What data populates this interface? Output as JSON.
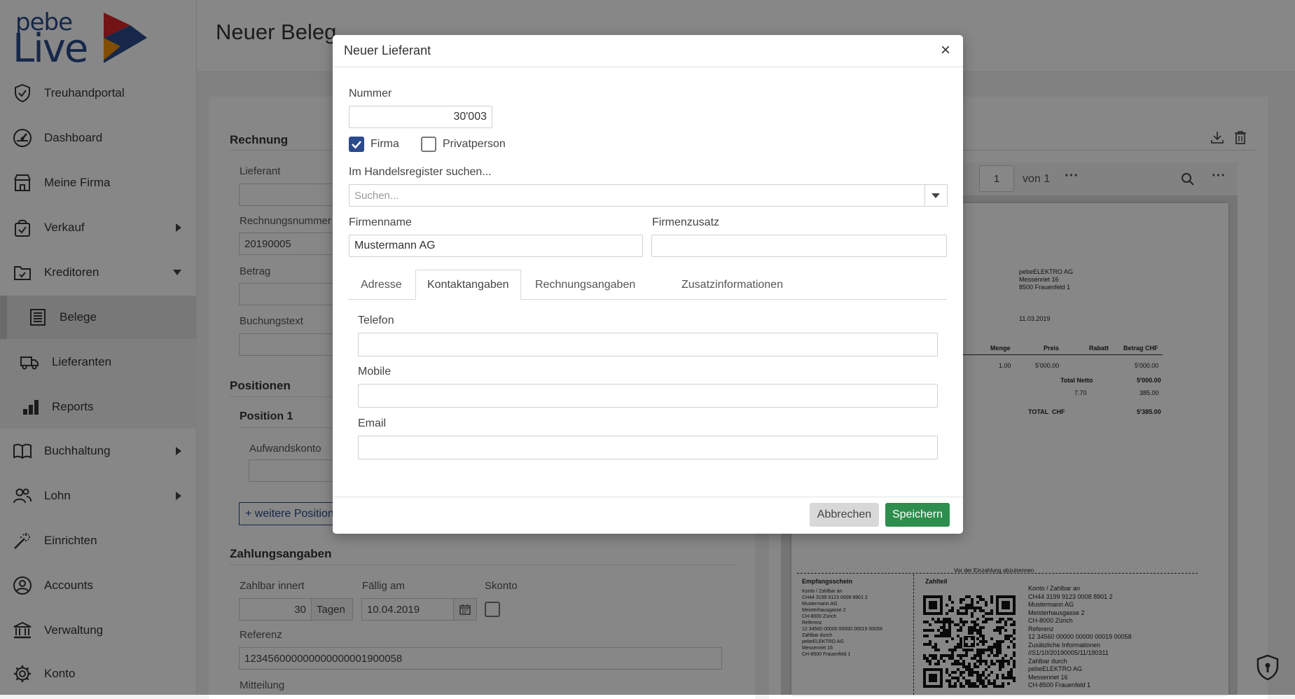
{
  "sidebar": {
    "logo": {
      "line1": "pebe",
      "line2": "Live"
    },
    "items": [
      {
        "label": "Treuhandportal"
      },
      {
        "label": "Dashboard"
      },
      {
        "label": "Meine Firma"
      },
      {
        "label": "Verkauf"
      },
      {
        "label": "Kreditoren"
      },
      {
        "label": "Buchhaltung"
      },
      {
        "label": "Lohn"
      },
      {
        "label": "Einrichten"
      },
      {
        "label": "Accounts"
      },
      {
        "label": "Verwaltung"
      },
      {
        "label": "Konto"
      }
    ],
    "subitems": [
      {
        "label": "Belege"
      },
      {
        "label": "Lieferanten"
      },
      {
        "label": "Reports"
      }
    ]
  },
  "page": {
    "title": "Neuer Beleg",
    "rechnung": {
      "title": "Rechnung",
      "lieferant_label": "Lieferant",
      "rechnungsnummer_label": "Rechnungsnummer",
      "rechnungsnummer_value": "20190005",
      "betrag_label": "Betrag",
      "buchungstext_label": "Buchungstext"
    },
    "positionen": {
      "title": "Positionen",
      "position_title": "Position 1",
      "aufwandskonto_label": "Aufwandskonto",
      "add_button": "+ weitere Position"
    },
    "zahlung": {
      "title": "Zahlungsangaben",
      "zahlbar_label": "Zahlbar innert",
      "zahlbar_value": "30",
      "zahlbar_unit": "Tagen",
      "faellig_label": "Fällig am",
      "faellig_value": "10.04.2019",
      "skonto_label": "Skonto",
      "referenz_label": "Referenz",
      "referenz_value": "123456000000000000001900058",
      "mitteilung_label": "Mitteilung"
    }
  },
  "pdf": {
    "page_value": "1",
    "page_of": "von 1",
    "address": [
      "pebeELEKTRO AG",
      "Messenriet 16",
      "8500 Frauenfeld 1"
    ],
    "date": "11.03.2019",
    "table_headers": [
      "Menge",
      "Preis",
      "Rabatt",
      "Betrag CHF"
    ],
    "row": [
      "1.00",
      "5'000.00",
      "5'000.00"
    ],
    "total_netto_label": "Total Netto",
    "total_netto_value": "5'000.00",
    "vat_rate": "7.70",
    "vat_value": "385.00",
    "total_label": "TOTAL  CHF",
    "total_value": "5'385.00",
    "cut_line": "Vor der Einzahlung abzutrennen",
    "empfangsschein": {
      "title": "Empfangsschein",
      "lines": [
        "Konto / Zahlbar an",
        "CH44 3199 9123 0008 8901 2",
        "Mustermann AG",
        "Meisterhausgasse 2",
        "CH-8000 Zürich",
        "Referenz",
        "12 34560 00000 00000 00019 00058",
        "Zahlbar durch",
        "pebeELEKTRO AG",
        "Messenriet 16",
        "CH-8500 Frauenfeld 1"
      ]
    },
    "zahlteil": {
      "title": "Zahlteil",
      "lines": [
        "Konto / Zahlbar an",
        "CH44 3199 9123 0008 8901 2",
        "Mustermann AG",
        "Meisterhausgasse 2",
        "CH-8000 Zürich",
        "Referenz",
        "12 34560 00000 00000 00019 00058",
        "Zusätzliche Informationen",
        "//S1/10/20190005/11/190311",
        "Zahlbar durch",
        "pebeELEKTRO AG",
        "Messenriet 16",
        "CH-8500 Frauenfeld 1"
      ]
    }
  },
  "modal": {
    "title": "Neuer Lieferant",
    "close": "×",
    "nummer_label": "Nummer",
    "nummer_value": "30'003",
    "firma_label": "Firma",
    "privatperson_label": "Privatperson",
    "handelsregister_label": "Im Handelsregister suchen...",
    "search_placeholder": "Suchen...",
    "firmenname_label": "Firmenname",
    "firmenname_value": "Mustermann AG",
    "firmenzusatz_label": "Firmenzusatz",
    "tabs": [
      {
        "label": "Adresse"
      },
      {
        "label": "Kontaktangaben"
      },
      {
        "label": "Rechnungsangaben"
      },
      {
        "label": "Zusatzinformationen"
      }
    ],
    "telefon_label": "Telefon",
    "mobile_label": "Mobile",
    "email_label": "Email",
    "cancel": "Abbrechen",
    "save": "Speichern"
  },
  "colors": {
    "brand_blue": "#2a4b8d",
    "save_green": "#2d8e4d",
    "logo_red": "#d9242b",
    "logo_orange": "#f39200"
  }
}
